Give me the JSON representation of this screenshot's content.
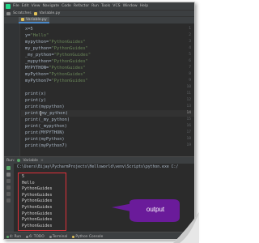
{
  "menu": {
    "items": [
      "File",
      "Edit",
      "View",
      "Navigate",
      "Code",
      "Refactor",
      "Run",
      "Tools",
      "VCS",
      "Window",
      "Help"
    ]
  },
  "breadcrumb": {
    "items": [
      "Scratches",
      "Variable.py"
    ]
  },
  "editor": {
    "active_tab": "Variable.py",
    "lines": [
      {
        "num": "1",
        "segments": [
          {
            "text": "x=5",
            "type": "plain"
          }
        ]
      },
      {
        "num": "2",
        "segments": [
          {
            "text": "y=",
            "type": "plain"
          },
          {
            "text": "\"Hello\"",
            "type": "str"
          }
        ]
      },
      {
        "num": "3",
        "segments": [
          {
            "text": "mypython=",
            "type": "plain"
          },
          {
            "text": "\"PythonGuides\"",
            "type": "str"
          }
        ]
      },
      {
        "num": "4",
        "segments": [
          {
            "text": "my_python=",
            "type": "plain"
          },
          {
            "text": "\"PythonGuides\"",
            "type": "str"
          }
        ]
      },
      {
        "num": "5",
        "segments": [
          {
            "text": "_my_python=",
            "type": "plain"
          },
          {
            "text": "\"PythonGuides\"",
            "type": "str"
          }
        ]
      },
      {
        "num": "6",
        "segments": [
          {
            "text": "_mypython=",
            "type": "plain"
          },
          {
            "text": "\"PythonGuides\"",
            "type": "str"
          }
        ]
      },
      {
        "num": "7",
        "segments": [
          {
            "text": "MYPYTHON=",
            "type": "plain"
          },
          {
            "text": "\"PythonGuides\"",
            "type": "str"
          }
        ]
      },
      {
        "num": "8",
        "segments": [
          {
            "text": "myPython=",
            "type": "plain"
          },
          {
            "text": "\"PythonGuides\"",
            "type": "str"
          }
        ]
      },
      {
        "num": "9",
        "segments": [
          {
            "text": "myPython7=",
            "type": "plain"
          },
          {
            "text": "\"PythonGuides\"",
            "type": "str"
          }
        ]
      },
      {
        "num": "10",
        "segments": []
      },
      {
        "num": "11",
        "segments": [
          {
            "text": "print(x)",
            "type": "plain"
          }
        ]
      },
      {
        "num": "12",
        "segments": [
          {
            "text": "print(y)",
            "type": "plain"
          }
        ]
      },
      {
        "num": "13",
        "segments": [
          {
            "text": "print(mypython)",
            "type": "plain"
          }
        ]
      },
      {
        "num": "14",
        "segments": [
          {
            "text": "print(",
            "type": "plain"
          },
          {
            "text": "cursor",
            "type": "cursor"
          },
          {
            "text": "my_python)",
            "type": "plain"
          }
        ],
        "current": true
      },
      {
        "num": "15",
        "segments": [
          {
            "text": "print(_my_python)",
            "type": "plain"
          }
        ]
      },
      {
        "num": "16",
        "segments": [
          {
            "text": "print(_mypython)",
            "type": "plain"
          }
        ]
      },
      {
        "num": "17",
        "segments": [
          {
            "text": "print(MYPYTHON)",
            "type": "plain"
          }
        ]
      },
      {
        "num": "18",
        "segments": [
          {
            "text": "print(myPython)",
            "type": "plain"
          }
        ]
      },
      {
        "num": "19",
        "segments": [
          {
            "text": "print(myPython7)",
            "type": "plain"
          }
        ]
      }
    ]
  },
  "run_panel": {
    "label": "Run:",
    "config": "Variable",
    "command": "C:\\Users\\Bijay\\PycharmProjects\\Helloworld\\venv\\Scripts\\python.exe C:/",
    "output": [
      "5",
      "Hello",
      "PythonGuides",
      "PythonGuides",
      "PythonGuides",
      "PythonGuides",
      "PythonGuides",
      "PythonGuides",
      "PythonGuides"
    ]
  },
  "bottom_bar": {
    "items": [
      "4: Run",
      "6: TODO",
      "Terminal",
      "Python Console"
    ]
  },
  "callout": {
    "label": "output"
  },
  "colors": {
    "ide_background": "#2b2b2b",
    "panel": "#3c3f41",
    "string": "#6a8759",
    "keyword_text": "#a9b7c6",
    "highlight_box": "#e0303a",
    "callout_fill": "#6a1b9a"
  }
}
